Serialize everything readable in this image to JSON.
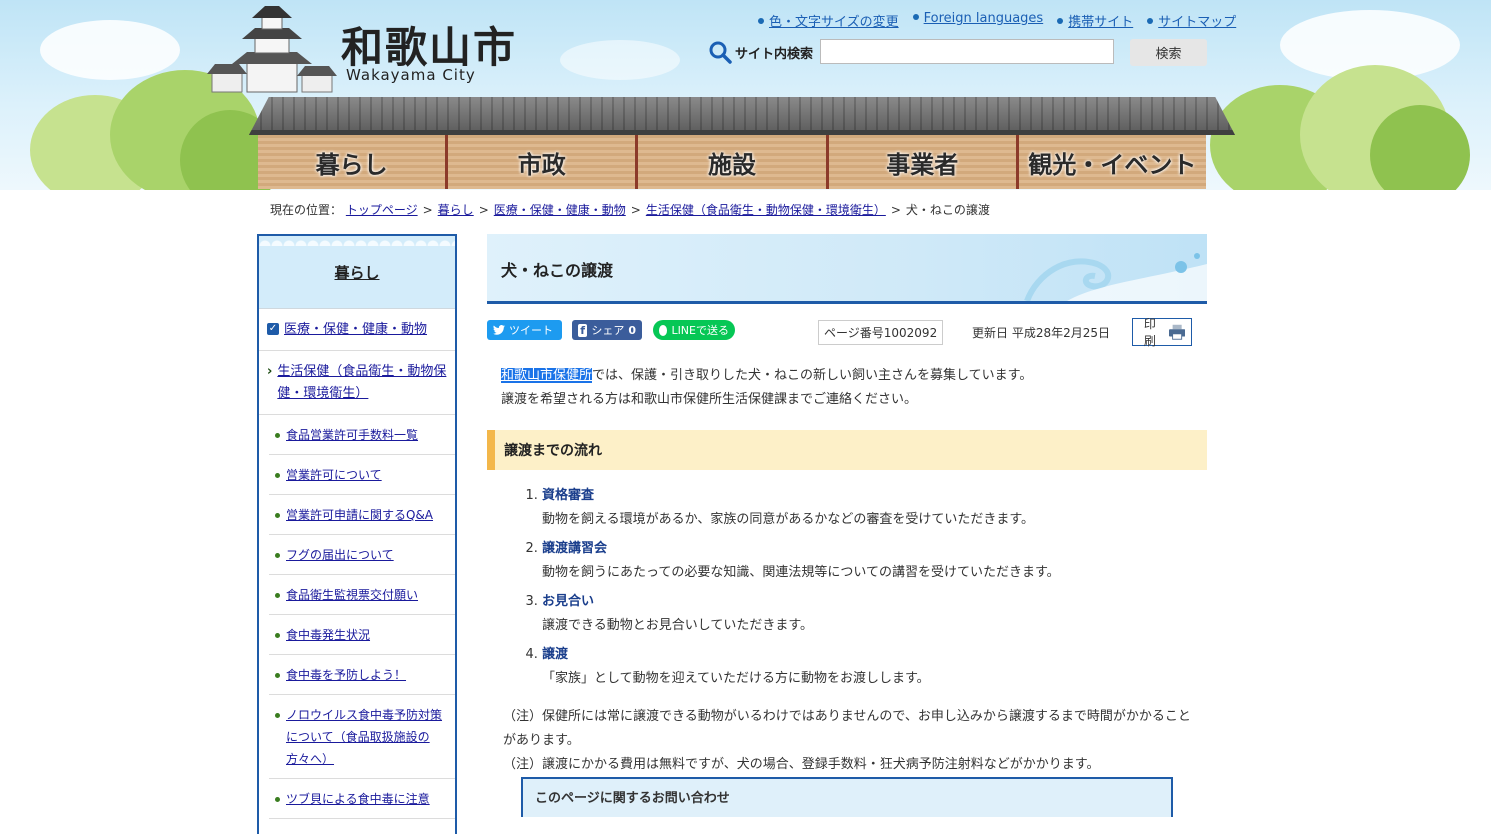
{
  "header": {
    "logo_ja": "和歌山市",
    "logo_en": "Wakayama City",
    "links": [
      "色・文字サイズの変更",
      "Foreign languages",
      "携帯サイト",
      "サイトマップ"
    ],
    "search_label": "サイト内検索",
    "search_placeholder": "",
    "search_button": "検索"
  },
  "nav": [
    "暮らし",
    "市政",
    "施設",
    "事業者",
    "観光・イベント"
  ],
  "breadcrumb": {
    "label": "現在の位置：",
    "items": [
      "トップページ",
      "暮らし",
      "医療・保健・健康・動物",
      "生活保健（食品衛生・動物保健・環境衛生）"
    ],
    "current": "犬・ねこの譲渡"
  },
  "sidebar": {
    "title": "暮らし",
    "category": "医療・保健・健康・動物",
    "subcategory": "生活保健（食品衛生・動物保健・環境衛生）",
    "items": [
      "食品営業許可手数料一覧",
      "営業許可について",
      "営業許可申請に関するQ&A",
      "フグの届出について",
      "食品衛生監視票交付願い",
      "食中毒発生状況",
      "食中毒を予防しよう！",
      "ノロウイルス食中毒予防対策について（食品取扱施設の方々へ）",
      "ツブ貝による食中毒に注意"
    ]
  },
  "main": {
    "title": "犬・ねこの譲渡",
    "sns": {
      "tweet": "ツイート",
      "share": "シェア",
      "share_count": "0",
      "line": "LINEで送る"
    },
    "page_number": "ページ番号1002092",
    "updated": "更新日 平成28年2月25日",
    "print": "印刷",
    "intro_highlight": "和歌山市保健所",
    "intro_rest": "では、保護・引き取りした犬・ねこの新しい飼い主さんを募集しています。",
    "intro_line2": "譲渡を希望される方は和歌山市保健所生活保健課までご連絡ください。",
    "section_title": "譲渡までの流れ",
    "steps": [
      {
        "title": "資格審査",
        "desc": "動物を飼える環境があるか、家族の同意があるかなどの審査を受けていただきます。"
      },
      {
        "title": "譲渡講習会",
        "desc": "動物を飼うにあたっての必要な知識、関連法規等についての講習を受けていただきます。"
      },
      {
        "title": "お見合い",
        "desc": "譲渡できる動物とお見合いしていただきます。"
      },
      {
        "title": "譲渡",
        "desc": "「家族」として動物を迎えていただける方に動物をお渡しします。"
      }
    ],
    "note1": "（注）保健所には常に譲渡できる動物がいるわけではありませんので、お申し込みから譲渡するまで時間がかかることがあります。",
    "note2": "（注）譲渡にかかる費用は無料ですが、犬の場合、登録手数料・狂犬病予防注射料などがかかります。",
    "contact_title": "このページに関するお問い合わせ"
  },
  "colors": {
    "accent": "#1e5ba8",
    "section_bg": "#fdf0c8",
    "section_bar": "#f3b74a"
  }
}
